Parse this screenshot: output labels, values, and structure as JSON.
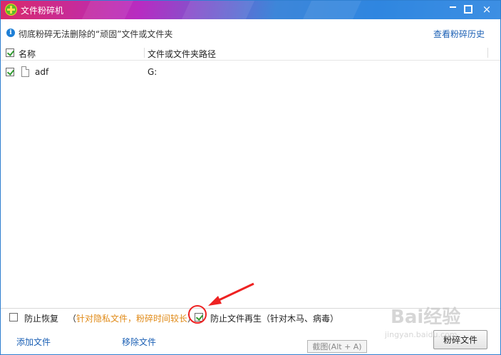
{
  "window": {
    "title": "文件粉碎机",
    "controls": {
      "minimize": "minimize-icon",
      "maximize": "maximize-icon",
      "close": "×"
    }
  },
  "infobar": {
    "text": "彻底粉碎无法删除的“顽固”文件或文件夹",
    "history_link": "查看粉碎历史"
  },
  "table": {
    "columns": [
      "名称",
      "文件或文件夹路径"
    ],
    "rows": [
      {
        "checked": true,
        "name": "adf",
        "path": "G:"
      }
    ]
  },
  "options": {
    "prevent_recovery": {
      "checked": false,
      "label": "防止恢复",
      "note_open": "（",
      "note": "针对隐私文件，粉碎时间较长",
      "note_close": "）"
    },
    "prevent_regen": {
      "checked": true,
      "label": "防止文件再生（针对木马、病毒）"
    }
  },
  "footer": {
    "add_files": "添加文件",
    "remove_files": "移除文件",
    "shred_button": "粉碎文件"
  },
  "overlay": {
    "tooltip": "截图(Alt + A)",
    "watermark": "Bai经验",
    "watermark_sub": "jingyan.baidu.com"
  },
  "colors": {
    "link": "#1a5fb4",
    "note": "#e08a17",
    "annotation": "#e22222"
  }
}
